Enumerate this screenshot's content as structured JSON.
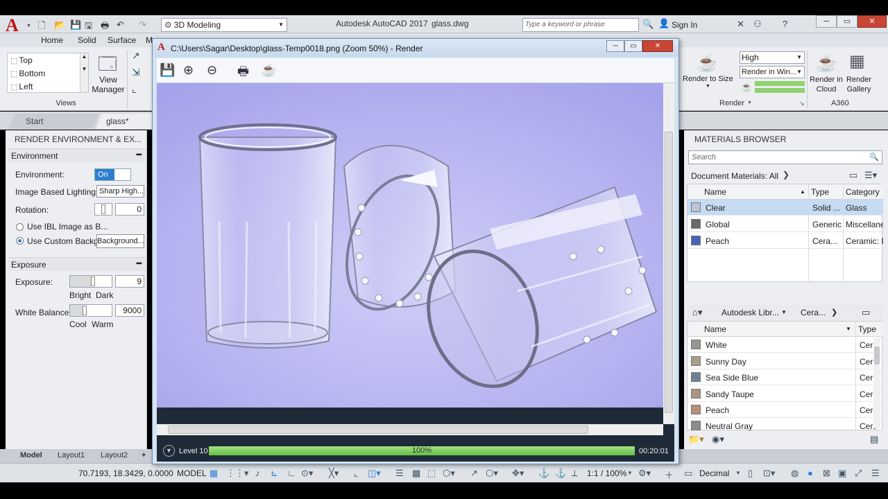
{
  "app": {
    "title": "Autodesk AutoCAD 2017",
    "file": "glass.dwg",
    "workspace": "3D Modeling",
    "search_placeholder": "Type a keyword or phrase",
    "sign_in": "Sign In",
    "logo_letter": "A"
  },
  "ribbon": {
    "tabs": [
      "Home",
      "Solid",
      "Surface",
      "M"
    ],
    "views": {
      "items": [
        "Top",
        "Bottom",
        "Left"
      ],
      "view_manager_label": "View Manager",
      "section_label": "Views"
    },
    "render": {
      "render_to_size_label": "Render to Size",
      "quality": "High",
      "render_in": "Render in Win...",
      "section_label": "Render"
    },
    "a360": {
      "cloud_label": "Render in Cloud",
      "gallery_label": "Render Gallery",
      "section_label": "A360"
    }
  },
  "doc_tabs": [
    "Start",
    "glass*"
  ],
  "render_env": {
    "title": "RENDER ENVIRONMENT & EX...",
    "environment_section": "Environment",
    "environment_label": "Environment:",
    "environment_value": "On",
    "ibl_label": "Image Based Lighting:",
    "ibl_value": "Sharp High...",
    "rotation_label": "Rotation:",
    "rotation_value": "0",
    "use_ibl_label": "Use IBL Image as B...",
    "use_custom_label": "Use Custom Backg...",
    "background_button": "Background...",
    "exposure_section": "Exposure",
    "exposure_label": "Exposure:",
    "exposure_value": "9",
    "bright_label": "Bright",
    "dark_label": "Dark",
    "white_balance_label": "White Balance:",
    "white_balance_value": "9000",
    "cool_label": "Cool",
    "warm_label": "Warm"
  },
  "materials": {
    "title": "MATERIALS BROWSER",
    "search_placeholder": "Search",
    "doc_materials_label": "Document Materials: All",
    "columns": [
      "Name",
      "Type",
      "Category"
    ],
    "doc_rows": [
      {
        "name": "Clear",
        "type": "Solid ...",
        "category": "Glass",
        "color": "#b9c4d4"
      },
      {
        "name": "Global",
        "type": "Generic",
        "category": "Miscellanec",
        "color": "#6a6a6a"
      },
      {
        "name": "Peach",
        "type": "Cera...",
        "category": "Ceramic: Po",
        "color": "#4a63b8"
      }
    ],
    "library_crumbs": [
      "Autodesk Libr...",
      "Cera..."
    ],
    "lib_columns": [
      "Name",
      "Type"
    ],
    "lib_rows": [
      {
        "name": "White",
        "type": "Ceran",
        "color": "#9a9590"
      },
      {
        "name": "Sunny Day",
        "type": "Ceran",
        "color": "#a89e8e"
      },
      {
        "name": "Sea Side Blue",
        "type": "Ceran",
        "color": "#6f7f96"
      },
      {
        "name": "Sandy Taupe",
        "type": "Ceran",
        "color": "#a89682"
      },
      {
        "name": "Peach",
        "type": "Ceran",
        "color": "#b88f78"
      },
      {
        "name": "Neutral Gray",
        "type": "Ceran",
        "color": "#8c8c8c"
      }
    ]
  },
  "render_window": {
    "title": "C:\\Users\\Sagar\\Desktop\\glass-Temp0018.png (Zoom 50%) - Render",
    "level": "Level 10",
    "progress_text": "100%",
    "progress": 1.0,
    "time": "00:20:01"
  },
  "layout_tabs": [
    "Model",
    "Layout1",
    "Layout2",
    "+"
  ],
  "status": {
    "coords": "70.7193, 18.3429, 0.0000",
    "mode": "MODEL",
    "scale": "1:1 / 100%",
    "units": "Decimal"
  },
  "colors": {
    "accent": "#2e7fd0",
    "progress_green": "#64bf44",
    "render_bg": "#a7a6eb"
  }
}
